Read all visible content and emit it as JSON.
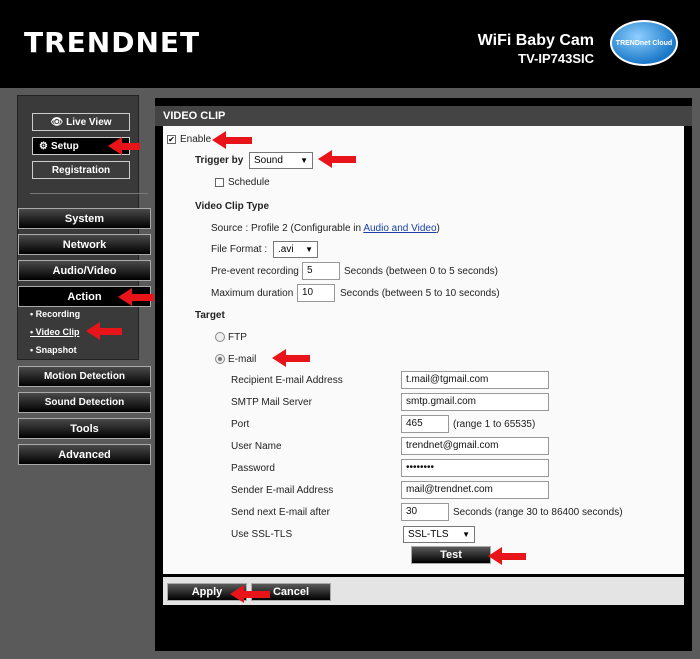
{
  "header": {
    "logo": "TRENDNET",
    "product": "WiFi Baby Cam",
    "model": "TV-IP743SIC",
    "cloud": "TRENDnet Cloud"
  },
  "sidebar": {
    "live_view": "Live View",
    "setup": "Setup",
    "registration": "Registration",
    "nav": [
      "System",
      "Network",
      "Audio/Video",
      "Action"
    ],
    "sub": [
      "Recording",
      "Video Clip",
      "Snapshot"
    ],
    "nav2": [
      "Motion Detection",
      "Sound Detection",
      "Tools",
      "Advanced"
    ]
  },
  "page": {
    "title": "VIDEO CLIP",
    "enable": "Enable",
    "trigger_label": "Trigger by",
    "trigger_value": "Sound",
    "schedule": "Schedule",
    "video_clip_type": "Video Clip Type",
    "source_text": "Source : Profile 2  (Configurable in ",
    "source_link": "Audio and Video",
    "source_close": ")",
    "file_format_label": "File Format :",
    "file_format_value": ".avi",
    "pre_event_label": "Pre-event recording",
    "pre_event_value": "5",
    "pre_event_hint": "Seconds   (between 0 to 5 seconds)",
    "max_dur_label": "Maximum duration",
    "max_dur_value": "10",
    "max_dur_hint": "Seconds   (between 5 to 10 seconds)",
    "target": "Target",
    "ftp": "FTP",
    "email": "E-mail",
    "recipient_label": "Recipient E-mail Address",
    "recipient_value": "t.mail@tgmail.com",
    "smtp_label": "SMTP Mail Server",
    "smtp_value": "smtp.gmail.com",
    "port_label": "Port",
    "port_value": "465",
    "port_hint": "(range 1 to 65535)",
    "user_label": "User Name",
    "user_value": "trendnet@gmail.com",
    "password_label": "Password",
    "password_value": "••••••••",
    "sender_label": "Sender E-mail Address",
    "sender_value": "mail@trendnet.com",
    "send_next_label": "Send next E-mail after",
    "send_next_value": "30",
    "send_next_hint": "Seconds   (range 30 to 86400 seconds)",
    "ssl_label": "Use SSL-TLS",
    "ssl_value": "SSL-TLS",
    "test": "Test",
    "apply": "Apply",
    "cancel": "Cancel"
  }
}
